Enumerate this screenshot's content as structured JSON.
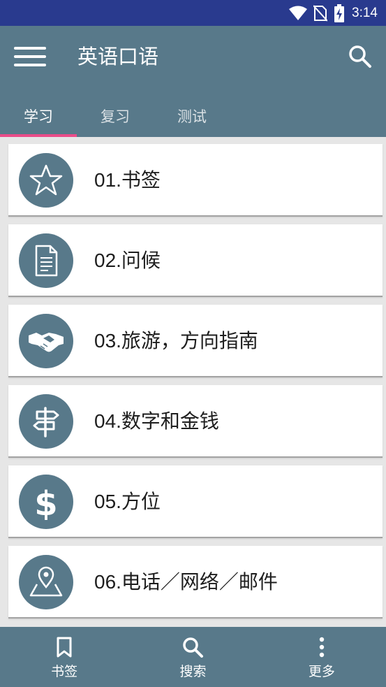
{
  "status_bar": {
    "time": "3:14"
  },
  "app_bar": {
    "title": "英语口语"
  },
  "tabs": [
    {
      "label": "学习",
      "active": true
    },
    {
      "label": "复习",
      "active": false
    },
    {
      "label": "测试",
      "active": false
    }
  ],
  "lessons": [
    {
      "label": "01.书签",
      "icon": "star-icon"
    },
    {
      "label": "02.问候",
      "icon": "document-icon"
    },
    {
      "label": "03.旅游，方向指南",
      "icon": "handshake-icon"
    },
    {
      "label": "04.数字和金钱",
      "icon": "signpost-icon"
    },
    {
      "label": "05.方位",
      "icon": "dollar-icon"
    },
    {
      "label": "06.电话／网络／邮件",
      "icon": "map-pin-icon"
    }
  ],
  "bottom_nav": [
    {
      "label": "书签",
      "icon": "bookmark-icon"
    },
    {
      "label": "搜索",
      "icon": "search-icon"
    },
    {
      "label": "更多",
      "icon": "more-vertical-icon"
    }
  ],
  "colors": {
    "status_bar": "#293a8e",
    "primary": "#58798a",
    "tab_indicator": "#ea4c89",
    "background": "#e6e6e6"
  }
}
